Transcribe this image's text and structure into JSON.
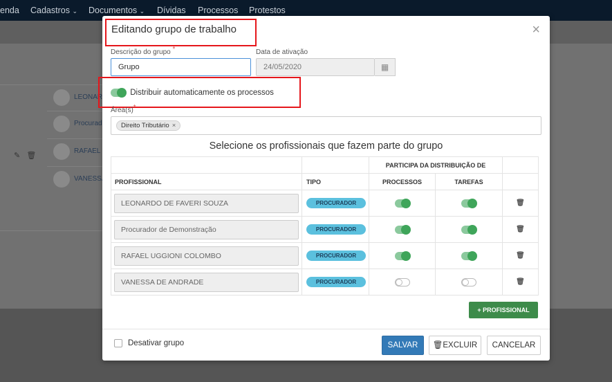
{
  "nav": {
    "items": [
      "enda",
      "Cadastros",
      "Documentos",
      "Dívidas",
      "Processos",
      "Protestos"
    ]
  },
  "background": {
    "members": [
      "LEONAR",
      "Procurad",
      "RAFAEL",
      "VANESSA"
    ]
  },
  "modal": {
    "title": "Editando grupo de trabalho",
    "close_label": "×",
    "description_label": "Descrição do grupo",
    "required_mark": "*",
    "description_value": "Grupo",
    "activation_label": "Data de ativação",
    "activation_value": "24/05/2020",
    "auto_distribute_label": "Distribuir automaticamente os processos",
    "areas_label": "Área(s)",
    "area_tags": [
      "Direito Tributário"
    ],
    "tag_remove": "×",
    "section_title": "Selecione os profissionais que fazem parte do grupo",
    "table": {
      "group_header": "PARTICIPA DA DISTRIBUIÇÃO DE",
      "col_profissional": "PROFISSIONAL",
      "col_tipo": "TIPO",
      "col_processos": "PROCESSOS",
      "col_tarefas": "TAREFAS",
      "rows": [
        {
          "name": "LEONARDO DE FAVERI SOUZA",
          "tipo": "PROCURADOR",
          "processos": true,
          "tarefas": true
        },
        {
          "name": "Procurador de Demonstração",
          "tipo": "PROCURADOR",
          "processos": true,
          "tarefas": true
        },
        {
          "name": "RAFAEL UGGIONI COLOMBO",
          "tipo": "PROCURADOR",
          "processos": true,
          "tarefas": true
        },
        {
          "name": "VANESSA DE ANDRADE",
          "tipo": "PROCURADOR",
          "processos": false,
          "tarefas": false
        }
      ]
    },
    "add_professional": "+ PROFISSIONAL",
    "disable_group_label": "Desativar grupo",
    "save": "SALVAR",
    "delete": "EXCLUIR",
    "cancel": "CANCELAR"
  },
  "colors": {
    "primary": "#337ab7",
    "success": "#3d8b4a",
    "toggle_on": "#3fa55a",
    "badge": "#5bc0de",
    "highlight": "#e5161b"
  }
}
